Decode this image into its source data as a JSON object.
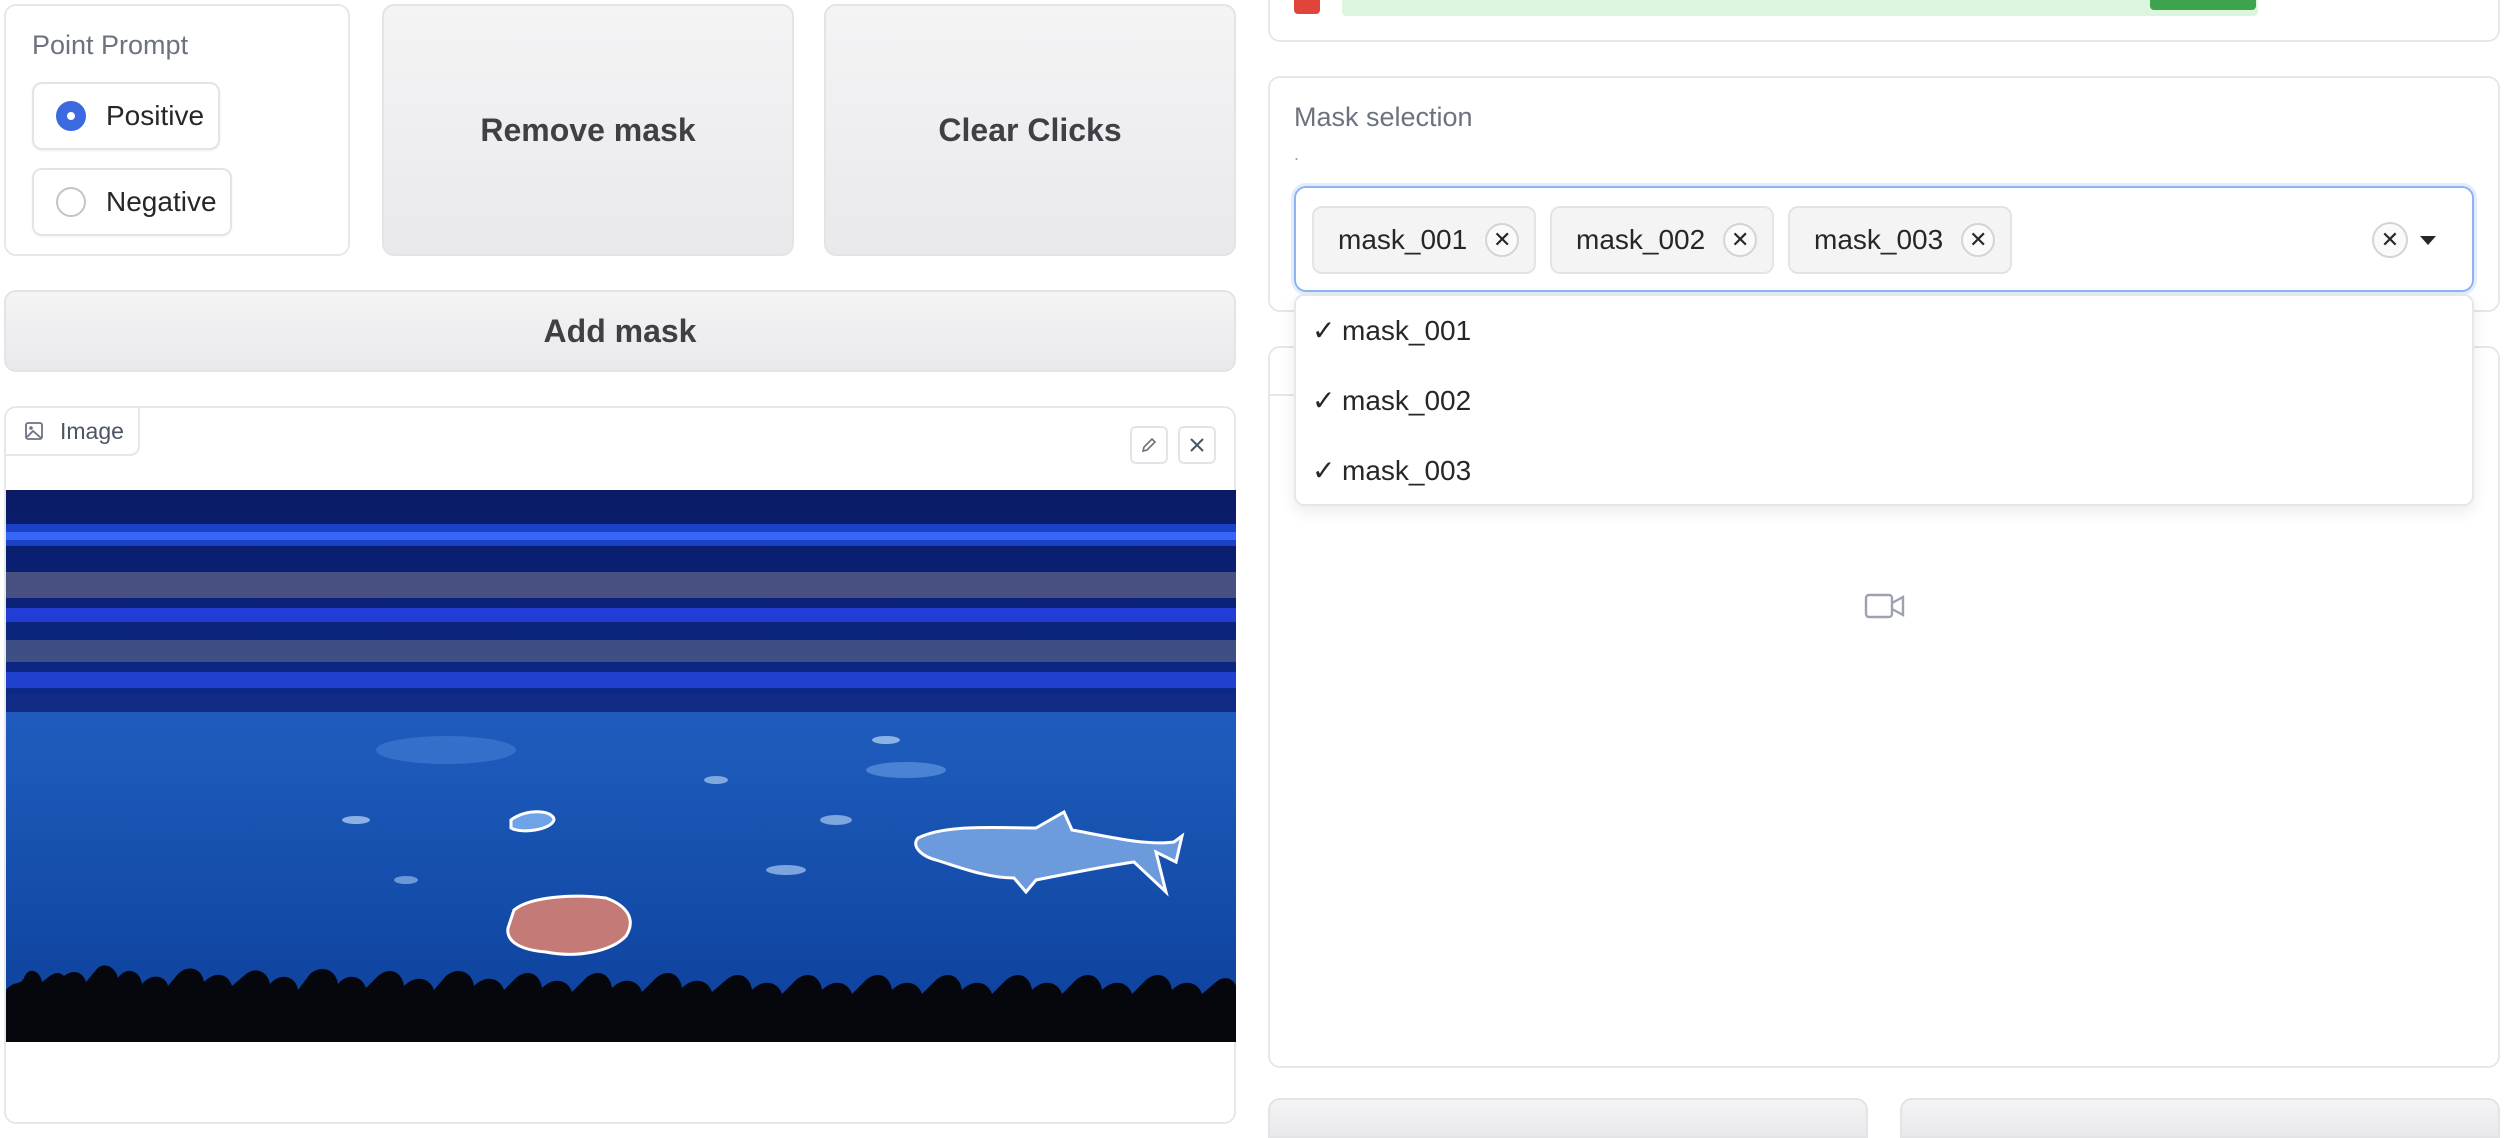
{
  "point_prompt": {
    "label": "Point Prompt",
    "options": [
      "Positive",
      "Negative"
    ],
    "selected": "Positive"
  },
  "buttons": {
    "remove_mask": "Remove mask",
    "clear_clicks": "Clear Clicks",
    "add_mask": "Add mask"
  },
  "image_panel": {
    "label": "Image",
    "icons": [
      "image-icon",
      "edit-icon",
      "close-icon"
    ]
  },
  "mask_selection": {
    "label": "Mask selection",
    "info": ".",
    "chips": [
      "mask_001",
      "mask_002",
      "mask_003"
    ],
    "dropdown_options": [
      {
        "check": "✓",
        "label": "mask_001"
      },
      {
        "check": "✓",
        "label": "mask_002"
      },
      {
        "check": "✓",
        "label": "mask_003"
      }
    ]
  },
  "video_panel": {
    "icon": "video-camera-icon"
  },
  "colors": {
    "accent": "#3b6ae0",
    "focus_border": "#8fb2f2",
    "mask_fill": "#c47a76",
    "mask_outline": "#ffffff"
  }
}
